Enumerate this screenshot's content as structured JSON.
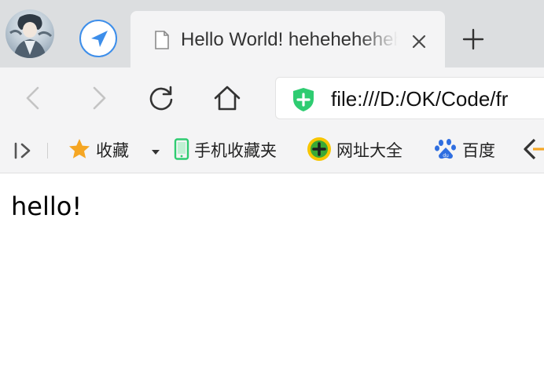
{
  "tab": {
    "title": "Hello World! hehehehehehe"
  },
  "omnibox": {
    "url": "file:///D:/OK/Code/fr"
  },
  "bookmarks": {
    "items": [
      {
        "label": "收藏",
        "icon": "star-icon"
      },
      {
        "label": "手机收藏夹",
        "icon": "mobile-icon"
      },
      {
        "label": "网址大全",
        "icon": "web-nav-icon"
      },
      {
        "label": "百度",
        "icon": "baidu-paw-icon"
      }
    ]
  },
  "page": {
    "text": "hello!"
  },
  "colors": {
    "tab_strip_bg": "#dcdee0",
    "toolbar_bg": "#f4f4f5",
    "shield_green": "#2ecc71",
    "accent_blue": "#3d8eea",
    "star_orange": "#f5a623"
  }
}
